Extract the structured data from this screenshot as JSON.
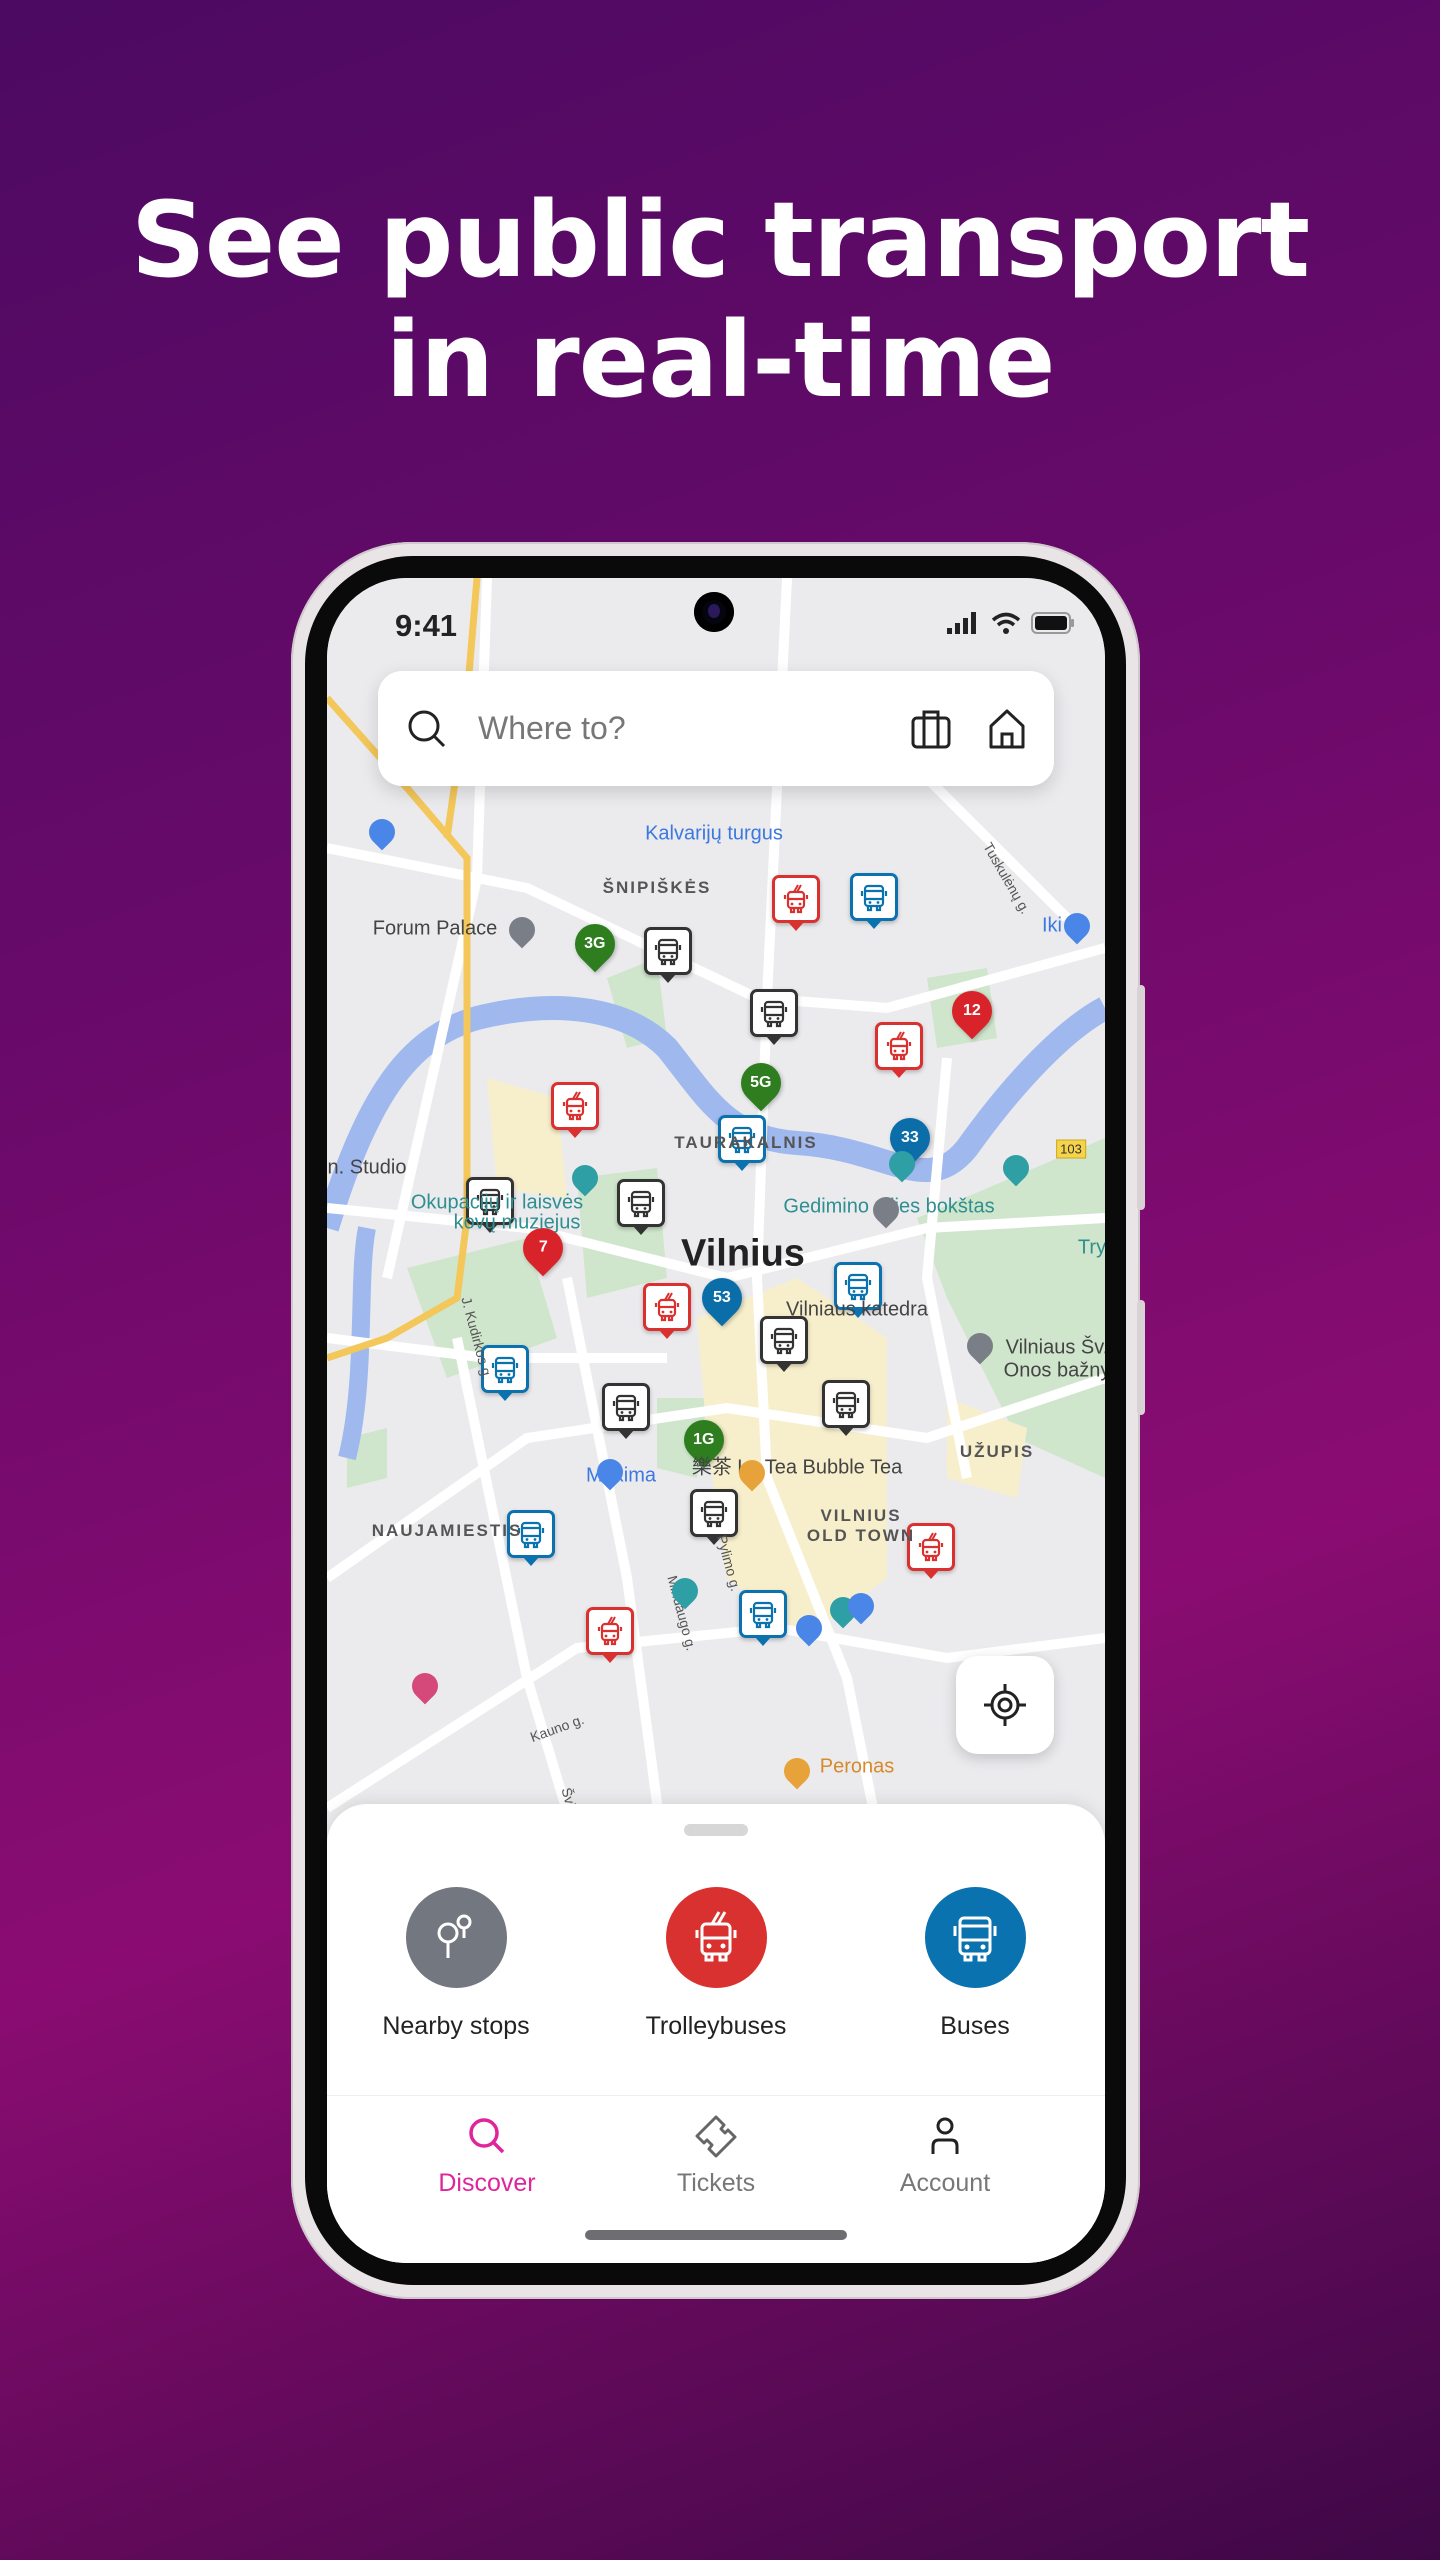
{
  "headline": {
    "line1": "See public transport",
    "line2": "in real-time"
  },
  "status_bar": {
    "time": "9:41"
  },
  "search": {
    "placeholder": "Where to?",
    "icons": [
      "search-icon",
      "briefcase-icon",
      "home-icon"
    ]
  },
  "map": {
    "city": "Vilnius",
    "areas": [
      "ŠNIPIŠKĖS",
      "TAURAKALNIS",
      "NAUJAMIESTIS",
      "VILNIUS",
      "OLD TOWN",
      "UŽUPIS"
    ],
    "pois": [
      "Kalvarijų turgus",
      "Forum Palace",
      "Iki",
      "n. Studio",
      "Okupacijų ir laisvės",
      "kovų muziejus",
      "Gedimino pilies bokštas",
      "Vilniaus katedra",
      "Vilniaus Šv.",
      "Onos bažny",
      "樂茶 Le Tea Bubble Tea",
      "Maxima",
      "Peronas",
      "Try"
    ],
    "streets": [
      "Tuskulėnų g.",
      "J. Kudirkos g.",
      "Pylimo g.",
      "Mindaugo g.",
      "Kauno g.",
      "Švitrigailos g."
    ],
    "road_shield": "103",
    "route_pins": [
      {
        "route": "3G",
        "color": "green"
      },
      {
        "route": "12",
        "color": "red"
      },
      {
        "route": "5G",
        "color": "green"
      },
      {
        "route": "33",
        "color": "blue"
      },
      {
        "route": "7",
        "color": "red"
      },
      {
        "route": "53",
        "color": "blue"
      },
      {
        "route": "1G",
        "color": "green"
      }
    ],
    "stop_markers": [
      "trolleybus",
      "bus",
      "stop",
      "stop",
      "trolleybus",
      "trolleybus",
      "bus",
      "stop",
      "stop",
      "trolleybus",
      "bus",
      "stop",
      "bus",
      "stop",
      "stop",
      "bus",
      "stop",
      "trolleybus",
      "bus",
      "trolleybus"
    ]
  },
  "categories": [
    {
      "label": "Nearby stops",
      "icon": "stops-icon",
      "color": "#737780"
    },
    {
      "label": "Trolleybuses",
      "icon": "trolleybus-icon",
      "color": "#d9312f"
    },
    {
      "label": "Buses",
      "icon": "bus-icon",
      "color": "#0b72b0"
    }
  ],
  "tabs": [
    {
      "label": "Discover",
      "icon": "search-icon",
      "active": true
    },
    {
      "label": "Tickets",
      "icon": "ticket-icon",
      "active": false
    },
    {
      "label": "Account",
      "icon": "person-icon",
      "active": false
    }
  ],
  "colors": {
    "accent": "#e0249a",
    "trolleybus": "#d9312f",
    "bus": "#0b72b0",
    "stop": "#333333",
    "regional": "#2e7d1e"
  }
}
